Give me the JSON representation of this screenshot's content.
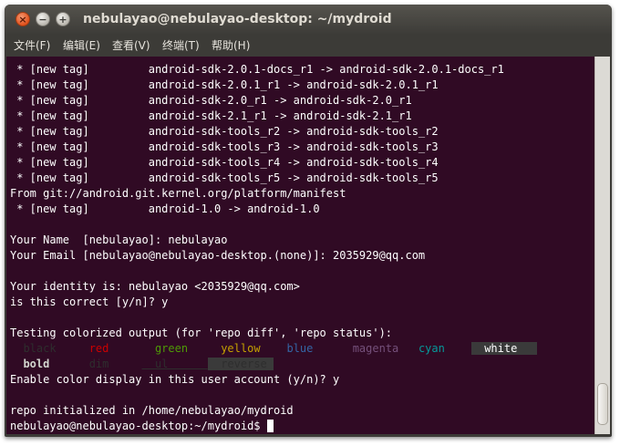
{
  "window": {
    "title": "nebulayao@nebulayao-desktop: ~/mydroid",
    "close_glyph": "×",
    "minimize_glyph": "−",
    "maximize_glyph": "+"
  },
  "menu": {
    "items": [
      "文件(F)",
      "编辑(E)",
      "查看(V)",
      "终端(T)",
      "帮助(H)"
    ]
  },
  "terminal": {
    "lines": [
      " * [new tag]         android-sdk-2.0.1-docs_r1 -> android-sdk-2.0.1-docs_r1",
      " * [new tag]         android-sdk-2.0.1_r1 -> android-sdk-2.0.1_r1",
      " * [new tag]         android-sdk-2.0_r1 -> android-sdk-2.0_r1",
      " * [new tag]         android-sdk-2.1_r1 -> android-sdk-2.1_r1",
      " * [new tag]         android-sdk-tools_r2 -> android-sdk-tools_r2",
      " * [new tag]         android-sdk-tools_r3 -> android-sdk-tools_r3",
      " * [new tag]         android-sdk-tools_r4 -> android-sdk-tools_r4",
      " * [new tag]         android-sdk-tools_r5 -> android-sdk-tools_r5",
      "From git://android.git.kernel.org/platform/manifest",
      " * [new tag]         android-1.0 -> android-1.0",
      "",
      "Your Name  [nebulayao]: nebulayao",
      "Your Email [nebulayao@nebulayao-desktop.(none)]: 2035929@qq.com",
      "",
      "Your identity is: nebulayao <2035929@qq.com>",
      "is this correct [y/n]? y",
      "",
      "Testing colorized output (for 'repo diff', 'repo status'):"
    ],
    "color_row": [
      {
        "text": "  black   ",
        "fg": "#2e2e2e",
        "bg": ""
      },
      {
        "text": "  red     ",
        "fg": "#cc0000",
        "bg": ""
      },
      {
        "text": "  green   ",
        "fg": "#4e9a06",
        "bg": ""
      },
      {
        "text": "  yellow  ",
        "fg": "#c4a000",
        "bg": ""
      },
      {
        "text": "  blue    ",
        "fg": "#3465a4",
        "bg": ""
      },
      {
        "text": "  magenta ",
        "fg": "#75507b",
        "bg": ""
      },
      {
        "text": "  cyan    ",
        "fg": "#06989a",
        "bg": ""
      },
      {
        "text": "  white   ",
        "fg": "#ffffff",
        "bg": "#3a3a3a"
      }
    ],
    "attr_row": [
      {
        "text": "  bold    ",
        "fg": "#d3d7cf",
        "bg": "",
        "weight": "bold",
        "decoration": ""
      },
      {
        "text": "  dim     ",
        "fg": "#2e2e2e",
        "bg": "",
        "weight": "normal",
        "decoration": ""
      },
      {
        "text": "  ul      ",
        "fg": "#2e2e2e",
        "bg": "",
        "weight": "normal",
        "decoration": "underline"
      },
      {
        "text": "  reverse ",
        "fg": "#2e2e2e",
        "bg": "#3a3a3a",
        "weight": "normal",
        "decoration": ""
      }
    ],
    "after_lines": [
      "Enable color display in this user account (y/n)? y",
      "",
      "repo initialized in /home/nebulayao/mydroid"
    ],
    "prompt": "nebulayao@nebulayao-desktop:~/mydroid$ "
  },
  "colors": {
    "terminal_bg": "#300a24",
    "terminal_fg": "#ffffff",
    "titlebar": "#3c3b37"
  }
}
